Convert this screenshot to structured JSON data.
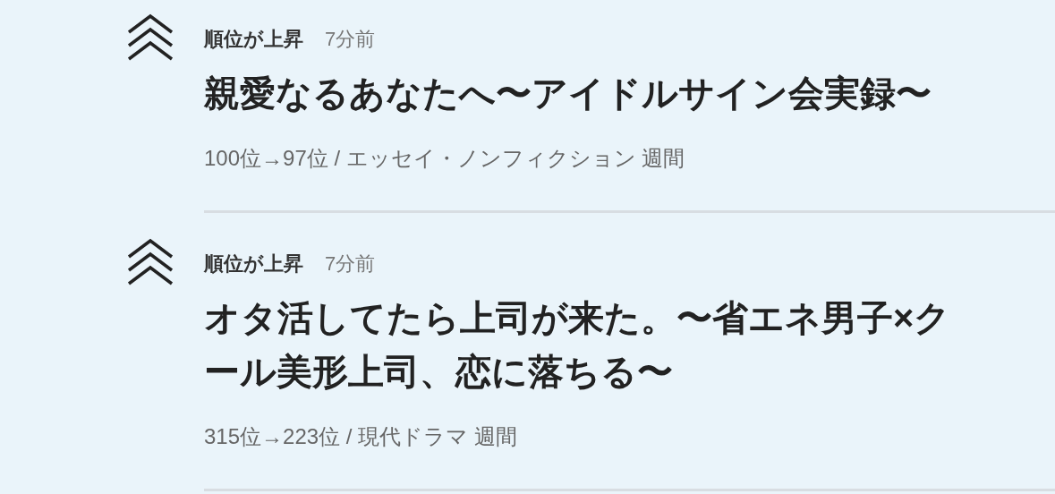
{
  "items": [
    {
      "label": "順位が上昇",
      "time": "7分前",
      "title": "親愛なるあなたへ〜アイドルサイン会実録〜",
      "meta": "100位→97位 / エッセイ・ノンフィクション 週間"
    },
    {
      "label": "順位が上昇",
      "time": "7分前",
      "title": "オタ活してたら上司が来た。〜省エネ男子×クール美形上司、恋に落ちる〜",
      "meta": "315位→223位 / 現代ドラマ 週間"
    }
  ]
}
